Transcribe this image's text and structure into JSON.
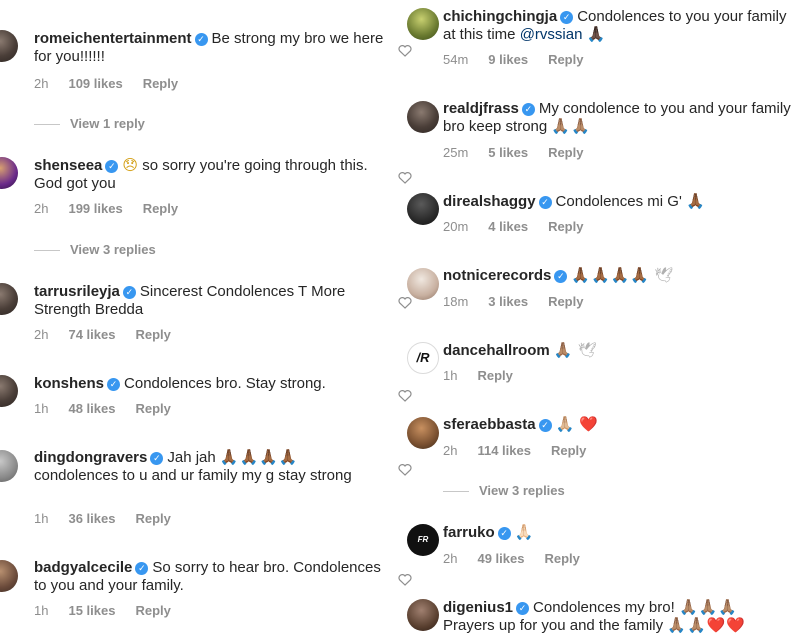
{
  "left": [
    {
      "user": "romeichentertainment",
      "text": "Be strong my bro we here for you!!!!!!",
      "time": "2h",
      "likes": "109 likes",
      "reply": "Reply",
      "view_replies": "View 1 reply"
    },
    {
      "user": "shenseea",
      "emoji": "😞",
      "text": "so sorry you're going through this. God got you",
      "time": "2h",
      "likes": "199 likes",
      "reply": "Reply",
      "view_replies": "View 3 replies"
    },
    {
      "user": "tarrusrileyja",
      "text": "Sincerest Condolences T More Strength Bredda",
      "time": "2h",
      "likes": "74 likes",
      "reply": "Reply"
    },
    {
      "user": "konshens",
      "text": "Condolences bro.  Stay strong.",
      "time": "1h",
      "likes": "48 likes",
      "reply": "Reply"
    },
    {
      "user": "dingdongravers",
      "text1": "Jah jah",
      "emoji": "🙏🏾🙏🏾🙏🏾🙏🏾",
      "text2": "condolences to u and ur family my g stay strong",
      "time": "1h",
      "likes": "36 likes",
      "reply": "Reply"
    },
    {
      "user": "badgyalcecile",
      "text": "So sorry to hear bro. Condolences to you and your family.",
      "time": "1h",
      "likes": "15 likes",
      "reply": "Reply"
    }
  ],
  "right": [
    {
      "user": "chichingchingja",
      "text1": "Condolences to you your family at this time",
      "mention": "@rvssian",
      "emoji": "🙏🏿",
      "time": "54m",
      "likes": "9 likes",
      "reply": "Reply"
    },
    {
      "user": "realdjfrass",
      "text": "My condolence to you and your family bro keep strong",
      "emoji": "🙏🏽🙏🏽",
      "time": "25m",
      "likes": "5 likes",
      "reply": "Reply"
    },
    {
      "user": "direalshaggy",
      "text": "Condolences mi G'",
      "emoji": "🙏🏾",
      "time": "20m",
      "likes": "4 likes",
      "reply": "Reply"
    },
    {
      "user": "notnicerecords",
      "emoji": "🙏🏾🙏🏾🙏🏾🙏🏾",
      "emoji2": "🕊",
      "time": "18m",
      "likes": "3 likes",
      "reply": "Reply"
    },
    {
      "user": "dancehallroom",
      "emoji": "🙏🏽",
      "emoji2": "🕊",
      "time": "1h",
      "reply": "Reply"
    },
    {
      "user": "sferaebbasta",
      "emoji": "🙏🏼",
      "emoji2": "❤️",
      "time": "2h",
      "likes": "114 likes",
      "reply": "Reply",
      "view_replies": "View 3 replies"
    },
    {
      "user": "farruko",
      "emoji": "🙏🏻",
      "time": "2h",
      "likes": "49 likes",
      "reply": "Reply"
    },
    {
      "user": "digenius1",
      "text": "Condolences my bro!",
      "emoji": "🙏🏽🙏🏽🙏🏽",
      "text2": "Prayers up for you and the family",
      "emoji2": "🙏🏽🙏🏽❤️❤️"
    }
  ]
}
